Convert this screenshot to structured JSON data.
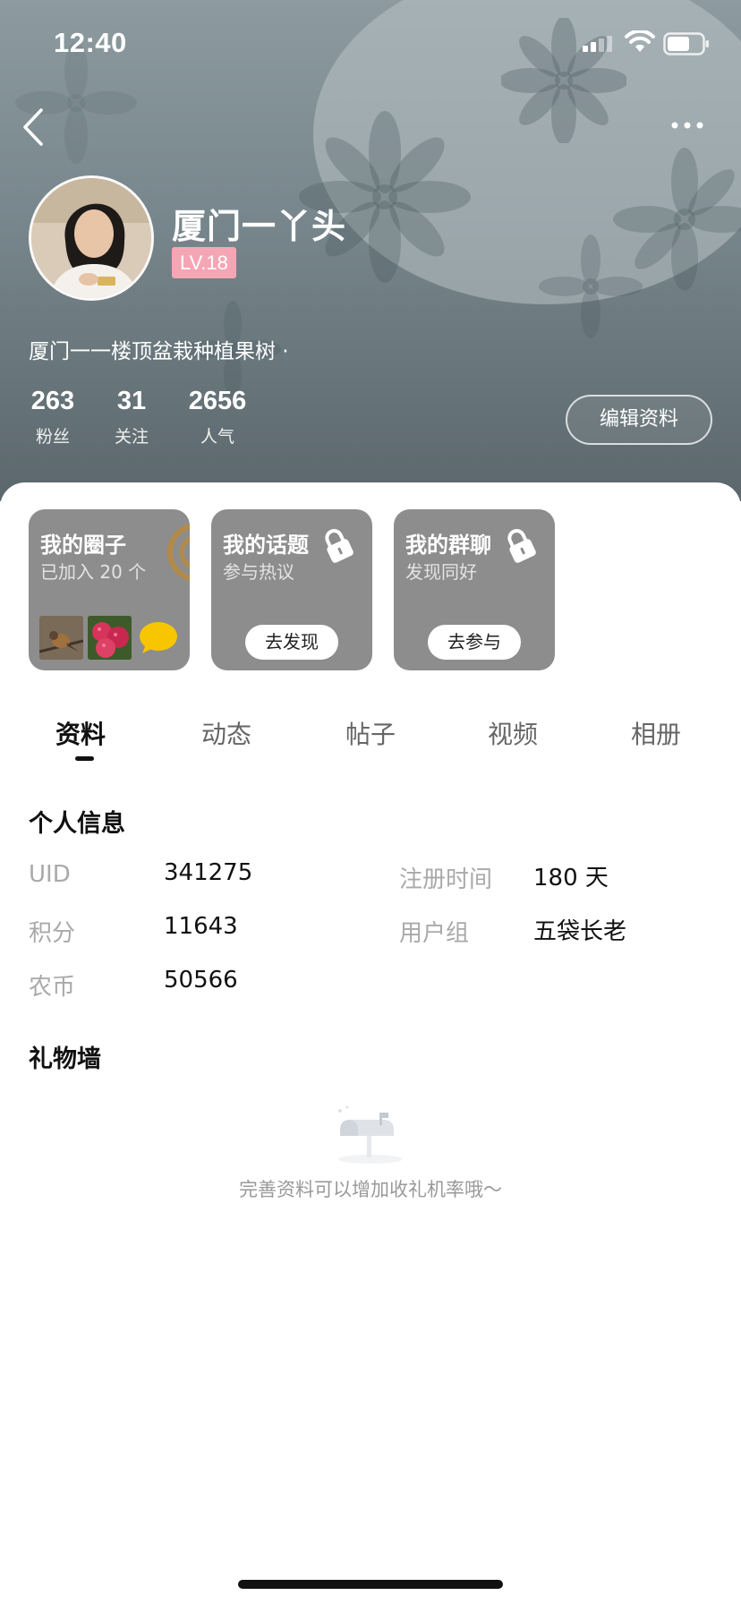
{
  "status_bar": {
    "time": "12:40"
  },
  "profile": {
    "name": "厦门一丫头",
    "level": "LV.18",
    "bio": "厦门一一楼顶盆栽种植果树 ·",
    "stats": [
      {
        "value": "263",
        "label": "粉丝"
      },
      {
        "value": "31",
        "label": "关注"
      },
      {
        "value": "2656",
        "label": "人气"
      }
    ],
    "edit_label": "编辑资料"
  },
  "cards": {
    "circle": {
      "title": "我的圈子",
      "subtitle": "已加入 20 个"
    },
    "topic": {
      "title": "我的话题",
      "subtitle": "参与热议",
      "action": "去发现"
    },
    "group": {
      "title": "我的群聊",
      "subtitle": "发现同好",
      "action": "去参与"
    }
  },
  "tabs": [
    "资料",
    "动态",
    "帖子",
    "视频",
    "相册"
  ],
  "active_tab": "资料",
  "personal_info": {
    "title": "个人信息",
    "fields": [
      {
        "label": "UID",
        "value": "341275"
      },
      {
        "label": "注册时间",
        "value": "180 天"
      },
      {
        "label": "积分",
        "value": "11643"
      },
      {
        "label": "用户组",
        "value": "五袋长老"
      },
      {
        "label": "农币",
        "value": "50566"
      }
    ]
  },
  "gift_wall": {
    "title": "礼物墙",
    "empty_text": "完善资料可以增加收礼机率哦～"
  },
  "icons": {
    "back": "chevron-left-icon",
    "more": "more-horizontal-icon",
    "lock": "lock-icon",
    "mailbox": "mailbox-icon"
  },
  "colors": {
    "level_badge": "#f5a6b4",
    "card_bg": "#8d8d8d",
    "chat_yellow": "#f7c600"
  }
}
